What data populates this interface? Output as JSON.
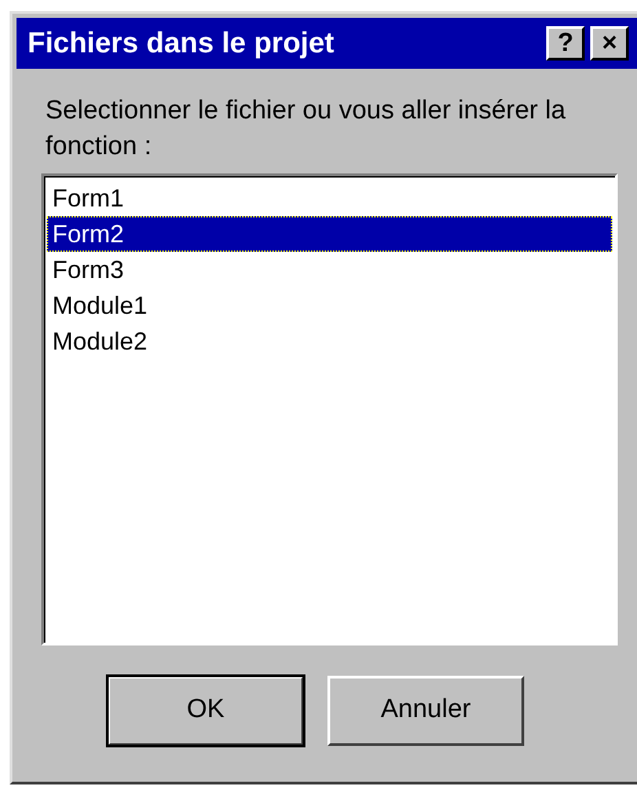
{
  "window": {
    "title": "Fichiers dans le projet",
    "title_buttons": [
      "?",
      "×"
    ]
  },
  "prompt": "Selectionner le fichier ou vous aller insérer la fonction :",
  "files": [
    {
      "label": "Form1",
      "selected": false
    },
    {
      "label": "Form2",
      "selected": true
    },
    {
      "label": "Form3",
      "selected": false
    },
    {
      "label": "Module1",
      "selected": false
    },
    {
      "label": "Module2",
      "selected": false
    }
  ],
  "buttons": [
    {
      "label": "OK",
      "default": true
    },
    {
      "label": "Annuler",
      "default": false
    }
  ]
}
